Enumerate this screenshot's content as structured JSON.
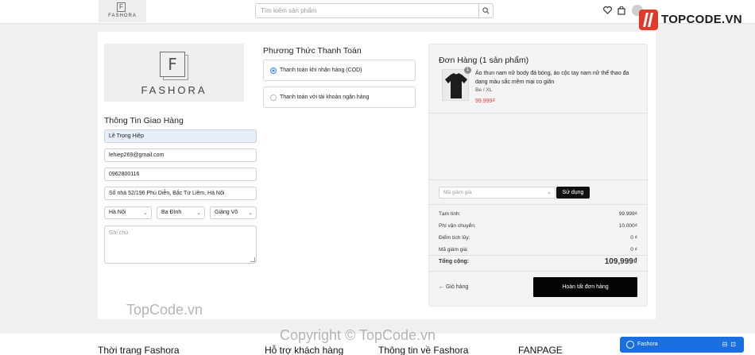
{
  "header": {
    "logo_letter": "F",
    "logo_word": "FASHORA",
    "search_placeholder": "Tìm kiếm sản phẩm"
  },
  "brand": {
    "logo_letter": "F",
    "logo_word": "FASHORA"
  },
  "shipping": {
    "title": "Thông Tin Giao Hàng",
    "name": "Lê Trọng Hiệp",
    "email": "lehiep269@gmail.com",
    "phone": "0962800116",
    "address": "Số nhà 52/196 Phú Diễn, Bắc Từ Liêm, Hà Nội",
    "city": "Hà Nội",
    "district": "Ba Đình",
    "ward": "Giảng Võ",
    "note_placeholder": "Ghi chú"
  },
  "payment": {
    "title": "Phương Thức Thanh Toán",
    "options": [
      {
        "label": "Thanh toán khi nhận hàng (COD)",
        "selected": true
      },
      {
        "label": "Thanh toán với tài khoản ngân hàng",
        "selected": false
      }
    ]
  },
  "order": {
    "title": "Đơn Hàng (1 sản phẩm)",
    "item": {
      "name": "Áo thun nam nữ body đá bóng, áo cộc tay nam nữ thể thao đa dạng màu sắc mềm mại co giãn",
      "variant": "Be / XL",
      "price": "99.999₫",
      "qty": "1"
    },
    "coupon_placeholder": "Mã giảm giá",
    "apply_label": "Sử dụng",
    "summary": {
      "subtotal_label": "Tạm tính:",
      "subtotal": "99.999₫",
      "shipping_label": "Phí vận chuyển:",
      "shipping": "10.000₫",
      "points_label": "Điểm tích lũy:",
      "points": "0 ₫",
      "discount_label": "Mã giảm giá:",
      "discount": "0 ₫",
      "total_label": "Tổng cộng:",
      "total": "109,999₫"
    },
    "back_label": "← Giỏ hàng",
    "finish_label": "Hoàn tất đơn hàng"
  },
  "footer": {
    "col1": "Thời trang Fashora",
    "col2": "Hỗ trợ khách hàng",
    "col3": "Thông tin về Fashora",
    "col4": "FANPAGE"
  },
  "chat": {
    "label": "Fashora"
  },
  "watermarks": {
    "logo_text": "TOPCODE.VN",
    "small": "TopCode.vn",
    "copyright": "Copyright © TopCode.vn"
  },
  "colors": {
    "accent": "#3b82f6",
    "price": "#e14141",
    "primary_button": "#050505",
    "chat": "#1a6fe0"
  }
}
